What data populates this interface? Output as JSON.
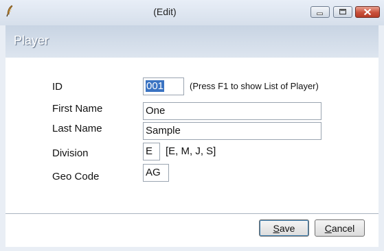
{
  "window": {
    "title": "(Edit)"
  },
  "header": {
    "title": "Player"
  },
  "form": {
    "id": {
      "label": "ID",
      "value": "001",
      "hint": "(Press F1 to show List of Player)"
    },
    "first_name": {
      "label": "First Name",
      "value": "One"
    },
    "last_name": {
      "label": "Last Name",
      "value": "Sample"
    },
    "division": {
      "label": "Division",
      "value": "E",
      "hint": "[E, M, J, S]"
    },
    "geo_code": {
      "label": "Geo Code",
      "value": "AG"
    }
  },
  "buttons": {
    "save": {
      "mnemonic": "S",
      "rest": "ave"
    },
    "cancel": {
      "mnemonic": "C",
      "rest": "ancel"
    }
  },
  "colors": {
    "selection": "#3a73c2",
    "title_bar": "#d6dfeb",
    "header_band": "#c8d4e3"
  },
  "icons": {
    "app": "quill-icon",
    "minimize": "minimize-icon",
    "maximize": "maximize-icon",
    "close": "close-icon"
  }
}
